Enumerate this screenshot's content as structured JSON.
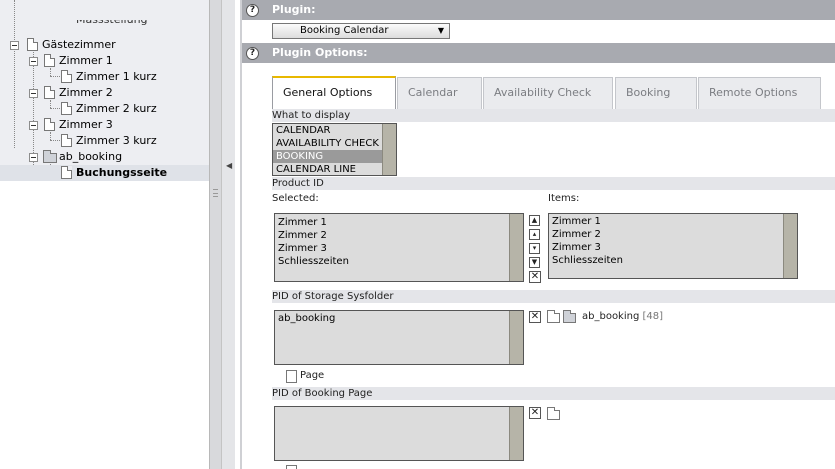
{
  "tree": {
    "items": [
      {
        "label": "Massstellung"
      },
      {
        "label": "Gästezimmer"
      },
      {
        "label": "Zimmer 1"
      },
      {
        "label": "Zimmer 1 kurz"
      },
      {
        "label": "Zimmer 2"
      },
      {
        "label": "Zimmer 2 kurz"
      },
      {
        "label": "Zimmer 3"
      },
      {
        "label": "Zimmer 3 kurz"
      },
      {
        "label": "ab_booking"
      },
      {
        "label": "Buchungsseite"
      }
    ]
  },
  "plugin": {
    "header": "Plugin:",
    "selected": "Booking Calendar"
  },
  "plugin_options": {
    "header": "Plugin Options:",
    "tabs": [
      {
        "label": "General Options",
        "active": true
      },
      {
        "label": "Calendar"
      },
      {
        "label": "Availability Check"
      },
      {
        "label": "Booking"
      },
      {
        "label": "Remote Options"
      }
    ]
  },
  "what_to_display": {
    "label": "What to display",
    "options": [
      "CALENDAR",
      "AVAILABILITY CHECK",
      "BOOKING",
      "CALENDAR LINE"
    ],
    "selected": "BOOKING"
  },
  "product_id": {
    "label": "Product ID",
    "selected_label": "Selected:",
    "items_label": "Items:",
    "selected": [
      "Zimmer 1",
      "Zimmer 2",
      "Zimmer 3",
      "Schliesszeiten"
    ],
    "items": [
      "Zimmer 1",
      "Zimmer 2",
      "Zimmer 3",
      "Schliesszeiten"
    ]
  },
  "storage_pid": {
    "label": "PID of Storage Sysfolder",
    "value": "ab_booking",
    "browser_item": "ab_booking",
    "browser_uid": "[48]",
    "page_link": "Page"
  },
  "booking_pid": {
    "label": "PID of Booking Page",
    "value": ""
  },
  "icons": {
    "help": "help-icon",
    "move_top": "move-top-icon",
    "move_up": "move-up-icon",
    "move_down": "move-down-icon",
    "move_bottom": "move-bottom-icon",
    "remove": "remove-icon",
    "folder": "folder-icon",
    "page": "page-icon"
  },
  "colors": {
    "section_header": "#a8aab0",
    "active_tab_accent": "#e8b800",
    "listbox_bg": "#dcdcdc",
    "selected_option": "#9a9a9a"
  }
}
